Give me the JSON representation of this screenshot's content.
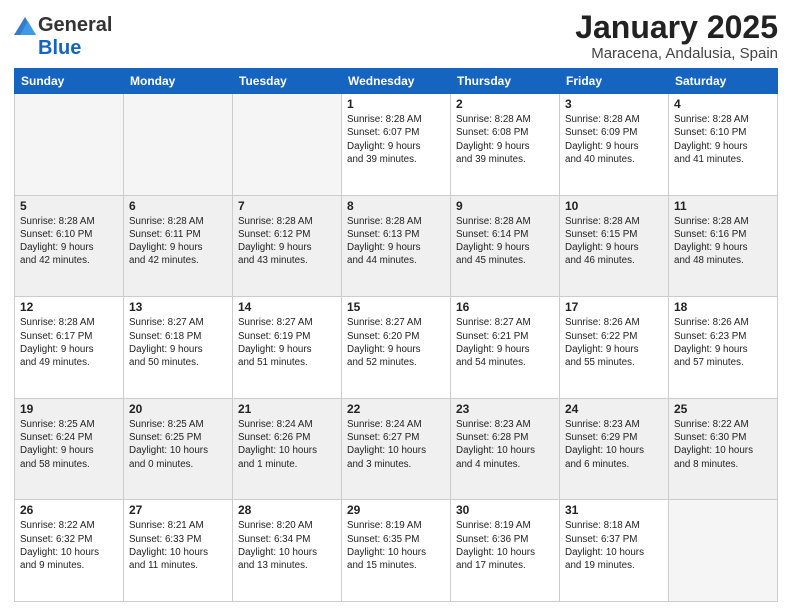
{
  "logo": {
    "general": "General",
    "blue": "Blue"
  },
  "title": "January 2025",
  "location": "Maracena, Andalusia, Spain",
  "days_of_week": [
    "Sunday",
    "Monday",
    "Tuesday",
    "Wednesday",
    "Thursday",
    "Friday",
    "Saturday"
  ],
  "weeks": [
    [
      {
        "day": "",
        "info": ""
      },
      {
        "day": "",
        "info": ""
      },
      {
        "day": "",
        "info": ""
      },
      {
        "day": "1",
        "info": "Sunrise: 8:28 AM\nSunset: 6:07 PM\nDaylight: 9 hours\nand 39 minutes."
      },
      {
        "day": "2",
        "info": "Sunrise: 8:28 AM\nSunset: 6:08 PM\nDaylight: 9 hours\nand 39 minutes."
      },
      {
        "day": "3",
        "info": "Sunrise: 8:28 AM\nSunset: 6:09 PM\nDaylight: 9 hours\nand 40 minutes."
      },
      {
        "day": "4",
        "info": "Sunrise: 8:28 AM\nSunset: 6:10 PM\nDaylight: 9 hours\nand 41 minutes."
      }
    ],
    [
      {
        "day": "5",
        "info": "Sunrise: 8:28 AM\nSunset: 6:10 PM\nDaylight: 9 hours\nand 42 minutes."
      },
      {
        "day": "6",
        "info": "Sunrise: 8:28 AM\nSunset: 6:11 PM\nDaylight: 9 hours\nand 42 minutes."
      },
      {
        "day": "7",
        "info": "Sunrise: 8:28 AM\nSunset: 6:12 PM\nDaylight: 9 hours\nand 43 minutes."
      },
      {
        "day": "8",
        "info": "Sunrise: 8:28 AM\nSunset: 6:13 PM\nDaylight: 9 hours\nand 44 minutes."
      },
      {
        "day": "9",
        "info": "Sunrise: 8:28 AM\nSunset: 6:14 PM\nDaylight: 9 hours\nand 45 minutes."
      },
      {
        "day": "10",
        "info": "Sunrise: 8:28 AM\nSunset: 6:15 PM\nDaylight: 9 hours\nand 46 minutes."
      },
      {
        "day": "11",
        "info": "Sunrise: 8:28 AM\nSunset: 6:16 PM\nDaylight: 9 hours\nand 48 minutes."
      }
    ],
    [
      {
        "day": "12",
        "info": "Sunrise: 8:28 AM\nSunset: 6:17 PM\nDaylight: 9 hours\nand 49 minutes."
      },
      {
        "day": "13",
        "info": "Sunrise: 8:27 AM\nSunset: 6:18 PM\nDaylight: 9 hours\nand 50 minutes."
      },
      {
        "day": "14",
        "info": "Sunrise: 8:27 AM\nSunset: 6:19 PM\nDaylight: 9 hours\nand 51 minutes."
      },
      {
        "day": "15",
        "info": "Sunrise: 8:27 AM\nSunset: 6:20 PM\nDaylight: 9 hours\nand 52 minutes."
      },
      {
        "day": "16",
        "info": "Sunrise: 8:27 AM\nSunset: 6:21 PM\nDaylight: 9 hours\nand 54 minutes."
      },
      {
        "day": "17",
        "info": "Sunrise: 8:26 AM\nSunset: 6:22 PM\nDaylight: 9 hours\nand 55 minutes."
      },
      {
        "day": "18",
        "info": "Sunrise: 8:26 AM\nSunset: 6:23 PM\nDaylight: 9 hours\nand 57 minutes."
      }
    ],
    [
      {
        "day": "19",
        "info": "Sunrise: 8:25 AM\nSunset: 6:24 PM\nDaylight: 9 hours\nand 58 minutes."
      },
      {
        "day": "20",
        "info": "Sunrise: 8:25 AM\nSunset: 6:25 PM\nDaylight: 10 hours\nand 0 minutes."
      },
      {
        "day": "21",
        "info": "Sunrise: 8:24 AM\nSunset: 6:26 PM\nDaylight: 10 hours\nand 1 minute."
      },
      {
        "day": "22",
        "info": "Sunrise: 8:24 AM\nSunset: 6:27 PM\nDaylight: 10 hours\nand 3 minutes."
      },
      {
        "day": "23",
        "info": "Sunrise: 8:23 AM\nSunset: 6:28 PM\nDaylight: 10 hours\nand 4 minutes."
      },
      {
        "day": "24",
        "info": "Sunrise: 8:23 AM\nSunset: 6:29 PM\nDaylight: 10 hours\nand 6 minutes."
      },
      {
        "day": "25",
        "info": "Sunrise: 8:22 AM\nSunset: 6:30 PM\nDaylight: 10 hours\nand 8 minutes."
      }
    ],
    [
      {
        "day": "26",
        "info": "Sunrise: 8:22 AM\nSunset: 6:32 PM\nDaylight: 10 hours\nand 9 minutes."
      },
      {
        "day": "27",
        "info": "Sunrise: 8:21 AM\nSunset: 6:33 PM\nDaylight: 10 hours\nand 11 minutes."
      },
      {
        "day": "28",
        "info": "Sunrise: 8:20 AM\nSunset: 6:34 PM\nDaylight: 10 hours\nand 13 minutes."
      },
      {
        "day": "29",
        "info": "Sunrise: 8:19 AM\nSunset: 6:35 PM\nDaylight: 10 hours\nand 15 minutes."
      },
      {
        "day": "30",
        "info": "Sunrise: 8:19 AM\nSunset: 6:36 PM\nDaylight: 10 hours\nand 17 minutes."
      },
      {
        "day": "31",
        "info": "Sunrise: 8:18 AM\nSunset: 6:37 PM\nDaylight: 10 hours\nand 19 minutes."
      },
      {
        "day": "",
        "info": ""
      }
    ]
  ]
}
